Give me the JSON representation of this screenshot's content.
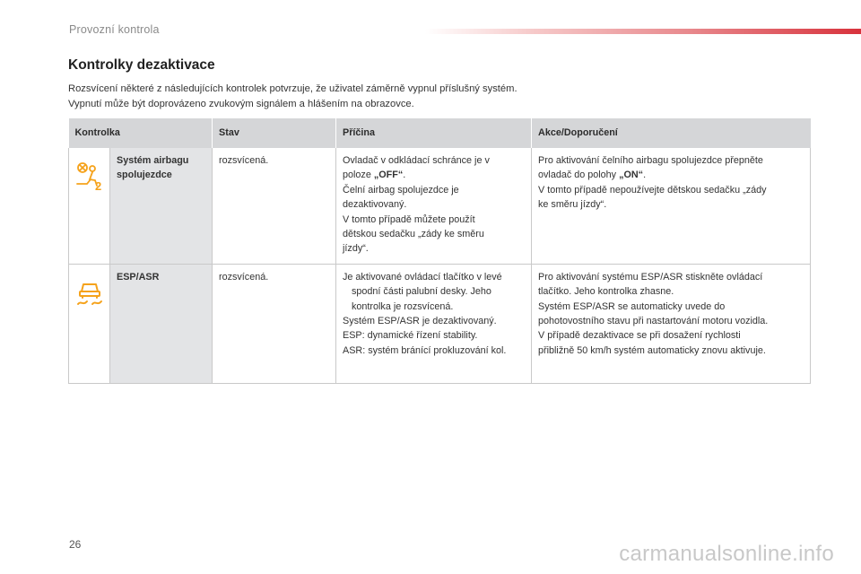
{
  "header": {
    "section_label": "Provozní kontrola"
  },
  "heading": "Kontrolky dezaktivace",
  "intro": {
    "line1": "Rozsvícení některé z následujících kontrolek potvrzuje, že uživatel záměrně vypnul příslušný systém.",
    "line2": "Vypnutí může být doprovázeno zvukovým signálem a hlášením na obrazovce."
  },
  "table": {
    "columns": [
      "Kontrolka",
      "Stav",
      "Příčina",
      "Akce/Doporučení"
    ],
    "rows": [
      {
        "icon": "airbag-off-icon",
        "name": "Systém airbagu spolujezdce",
        "state": "rozsvícená.",
        "cause": {
          "l1": "Ovladač v odkládací schránce je v",
          "l2_pre": "poloze ",
          "l2_bold": "„OFF“",
          "l2_post": ".",
          "l3": "Čelní airbag spolujezdce je",
          "l4": "dezaktivovaný.",
          "l5": "V tomto případě můžete použít",
          "l6": "dětskou sedačku „zády ke směru",
          "l7": "jízdy“."
        },
        "action": {
          "l1": "Pro aktivování čelního airbagu spolujezdce přepněte",
          "l2_pre": "ovladač do polohy ",
          "l2_bold": "„ON“",
          "l2_post": ".",
          "l3": "V tomto případě nepoužívejte dětskou sedačku „zády",
          "l4": "ke směru jízdy“."
        }
      },
      {
        "icon": "esp-off-icon",
        "name": "ESP/ASR",
        "state": "rozsvícená.",
        "cause": {
          "l1": "Je aktivované ovládací tlačítko v levé",
          "l2": "spodní části palubní desky. Jeho",
          "l3": "kontrolka je rozsvícená.",
          "l4": "Systém ESP/ASR je dezaktivovaný.",
          "l5": "ESP: dynamické řízení stability.",
          "l6": "ASR: systém bránící prokluzování kol."
        },
        "action": {
          "l1": "Pro aktivování systému ESP/ASR stiskněte ovládací",
          "l2": "tlačítko. Jeho kontrolka zhasne.",
          "l3": "Systém ESP/ASR se automaticky uvede do",
          "l4": "pohotovostního stavu při nastartování motoru vozidla.",
          "l5": "V případě dezaktivace se při dosažení rychlosti",
          "l6": "přibližně 50 km/h systém automaticky znovu aktivuje."
        }
      }
    ]
  },
  "page_number": "26",
  "watermark": "carmanualsonline.info",
  "colors": {
    "icon_accent": "#f5a21b",
    "header_gray": "#d5d6d8",
    "name_cell_gray": "#e3e4e6",
    "bar_red": "#d8323c"
  }
}
